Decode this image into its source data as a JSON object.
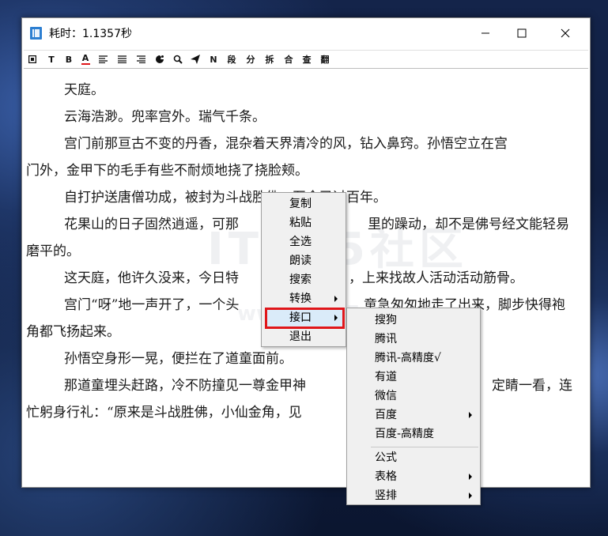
{
  "window": {
    "title": "耗时：1.1357秒"
  },
  "toolbar": {
    "items": [
      {
        "label": "◻",
        "name": "clipboard-icon"
      },
      {
        "label": "T",
        "name": "text-tool"
      },
      {
        "label": "B",
        "name": "bold-tool"
      },
      {
        "label": "A",
        "name": "font-color-tool"
      },
      {
        "label": "☰",
        "name": "align-left-icon"
      },
      {
        "label": "☰",
        "name": "align-justify-icon"
      },
      {
        "label": "☰",
        "name": "align-right-icon"
      },
      {
        "label": "◆",
        "name": "palette-icon"
      },
      {
        "label": "⚲",
        "name": "search-icon"
      },
      {
        "label": "➤",
        "name": "send-icon"
      },
      {
        "label": "N",
        "name": "normal-tool"
      },
      {
        "label": "段",
        "name": "paragraph-tool"
      },
      {
        "label": "分",
        "name": "split-tool"
      },
      {
        "label": "拆",
        "name": "break-tool"
      },
      {
        "label": "合",
        "name": "merge-tool"
      },
      {
        "label": "查",
        "name": "find-tool"
      },
      {
        "label": "翻",
        "name": "translate-tool"
      }
    ]
  },
  "content": {
    "lines": [
      "天庭。",
      "云海浩渺。兜率宫外。瑞气千条。",
      "宫门前那亘古不变的丹香，混杂着天界清冷的风，钻入鼻窍。孙悟空立在宫",
      "门外，金甲下的毛手有些不耐烦地挠了挠脸颊。",
      "自打护送唐僧功成，被封为斗战胜佛，至今已过百年。",
      "花果山的日子固然逍遥，可那骨子里的躁动，却不是佛号经文能轻易",
      "磨平的。",
      "这天庭，他许久没来，今日特意寻了个由头，上来找故人活动活动筋骨。",
      "宫门“呀”地一声开了，一个头扎双髻的道童急匆匆地走了出来，脚步快得袍",
      "角都飞扬起来。",
      "孙悟空身形一晃，便拦在了道童面前。",
      "那道童埋头赶路，冷不防撞见一尊金甲神将立在眼前，吓了一跳，定睛一看，连",
      "忙躬身行礼：“原来是斗战胜佛，小仙金角，见过大圣！”"
    ],
    "visible_lines": [
      "天庭。",
      "云海浩渺。兜率宫外。瑞气千条。",
      "宫门前那亘古不变的丹香，混杂着天界清冷的风，钻入鼻窍。孙悟空立在宫",
      "门外，金甲下的毛手有些不耐烦地挠了挠脸颊。",
      "自打护送唐僧功成，被封为斗战胜佛，至今已过百年。",
      "花果山的日子固然逍遥，可那",
      "里的躁动，却不是佛号经文能轻易",
      "磨平的。",
      "这天庭，他许久没来，今日特",
      "，上来找故人活动活动筋骨。",
      "宫门“呀”地一声开了，一个头",
      "童急匆匆地走了出来，脚步快得袍",
      "角都飞扬起来。",
      "孙悟空身形一晃，便拦在了道童面前。",
      "那道童埋头赶路，冷不防撞见一尊金甲神",
      "定睛一看，连",
      "忙躬身行礼：“原来是斗战胜佛，小仙金角，见"
    ]
  },
  "watermark": {
    "text": "IT365社区",
    "sub": "www.it365.cn"
  },
  "context_menu": {
    "items": [
      "复制",
      "粘贴",
      "全选",
      "朗读",
      "搜索",
      "转换",
      "接口",
      "退出"
    ]
  },
  "submenu": {
    "group1": [
      "搜狗",
      "腾讯",
      "腾讯-高精度√",
      "有道",
      "微信",
      "百度",
      "百度-高精度"
    ],
    "group2": [
      "公式",
      "表格",
      "竖排"
    ]
  },
  "colors": {
    "highlight_border": "#e0161a",
    "menu_bg": "#f0f0f0"
  }
}
